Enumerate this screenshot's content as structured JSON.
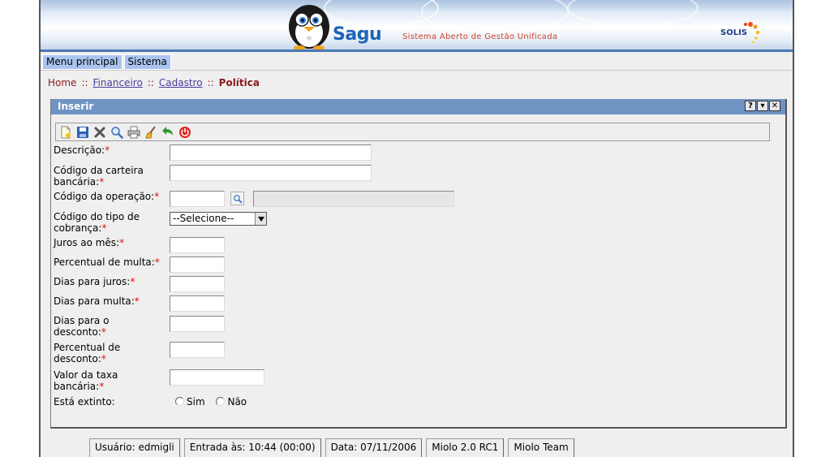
{
  "banner": {
    "title": "Sagu",
    "subtitle": "Sistema Aberto de Gestão Unificada",
    "partner_logo": "SOLIS",
    "colors": {
      "brand_blue": "#1e63b8",
      "subtitle_red": "#d0452a",
      "accent_blue": "#4a78b4"
    }
  },
  "menu": {
    "items": [
      {
        "label": "Menu principal"
      },
      {
        "label": "Sistema"
      }
    ]
  },
  "breadcrumb": {
    "home": "Home",
    "sep": "::",
    "items": [
      "Financeiro",
      "Cadastro"
    ],
    "current": "Política"
  },
  "panel": {
    "title": "Inserir",
    "window_buttons": [
      "?",
      "▾",
      "✕"
    ],
    "toolbar_icons": [
      "new-icon",
      "save-icon",
      "delete-icon",
      "search-icon",
      "print-icon",
      "clear-icon",
      "back-icon",
      "exit-icon"
    ]
  },
  "form": {
    "required_mark": "*",
    "fields": {
      "descricao": {
        "label": "Descrição:",
        "value": ""
      },
      "codigo_carteira": {
        "label_1": "Código da carteira",
        "label_2": "bancária:",
        "value": ""
      },
      "codigo_operacao": {
        "label": "Código da operação:",
        "value": "",
        "description": ""
      },
      "codigo_tipo_cobranca": {
        "label_1": "Código do tipo de",
        "label_2": "cobrança:",
        "selected": "--Selecione--"
      },
      "juros_mes": {
        "label": "Juros ao mês:",
        "value": ""
      },
      "percentual_multa": {
        "label": "Percentual de multa:",
        "value": ""
      },
      "dias_juros": {
        "label": "Dias para juros:",
        "value": ""
      },
      "dias_multa": {
        "label": "Dias para multa:",
        "value": ""
      },
      "dias_desconto": {
        "label_1": "Dias para o",
        "label_2": "desconto:",
        "value": ""
      },
      "percentual_desconto": {
        "label_1": "Percentual de",
        "label_2": "desconto:",
        "value": ""
      },
      "valor_taxa": {
        "label_1": "Valor da taxa",
        "label_2": "bancária:",
        "value": ""
      },
      "esta_extinto": {
        "label": "Está extinto:",
        "options": [
          "Sim",
          "Não"
        ],
        "selected": null
      }
    }
  },
  "statusbar": {
    "usuario": "Usuário: edmigli",
    "entrada": "Entrada às: 10:44 (00:00)",
    "data": "Data: 07/11/2006",
    "versao": "Miolo 2.0 RC1",
    "team": "Miolo Team"
  }
}
